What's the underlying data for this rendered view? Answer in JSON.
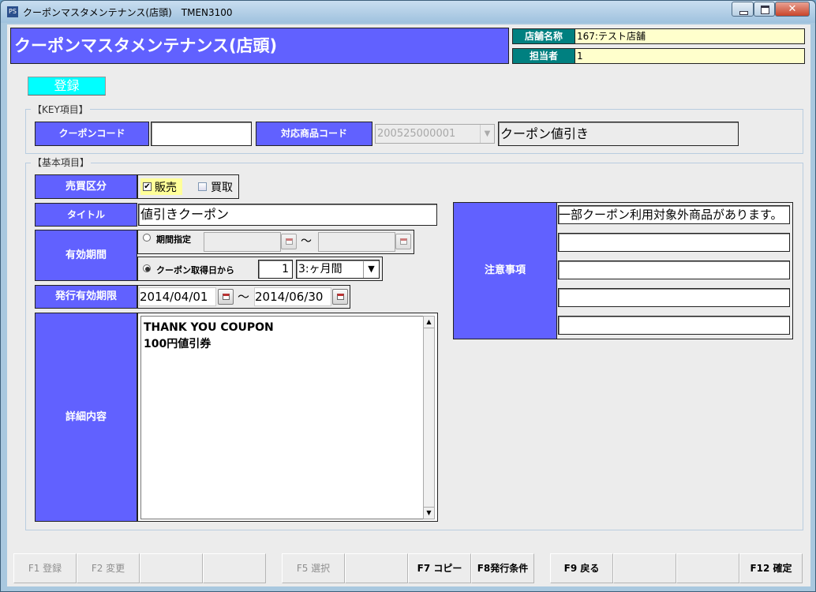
{
  "window": {
    "title": "クーポンマスタメンテナンス(店頭)　TMEN3100",
    "app_icon": "app-icon"
  },
  "header": {
    "title": "クーポンマスタメンテナンス(店頭)",
    "store_label": "店舗名称",
    "store_value": "167:テスト店舗",
    "staff_label": "担当者",
    "staff_value": "1"
  },
  "register_button": "登録",
  "key_section": {
    "legend": "【KEY項目】",
    "coupon_code_label": "クーポンコード",
    "coupon_code_value": "",
    "product_code_label": "対応商品コード",
    "product_code_value": "200525000001",
    "product_name": "クーポン値引き"
  },
  "basic_section": {
    "legend": "【基本項目】",
    "trade_label": "売買区分",
    "sale_label": "販売",
    "sale_checked": true,
    "buy_label": "買取",
    "buy_checked": false,
    "title_label": "タイトル",
    "title_value": "値引きクーポン",
    "validity_label": "有効期間",
    "period_radio_label": "期間指定",
    "tilde": "～",
    "from_acquire_label": "クーポン取得日から",
    "acquire_count": "1",
    "acquire_unit": "3:ヶ月間",
    "issue_label": "発行有効期限",
    "issue_from": "2014/04/01",
    "issue_to": "2014/06/30",
    "detail_label": "詳細内容",
    "detail_line1": "THANK YOU COUPON",
    "detail_line2": "100円値引券",
    "notes_label": "注意事項",
    "notes": [
      "一部クーポン利用対象外商品があります。",
      "",
      "",
      "",
      ""
    ]
  },
  "fkeys": [
    {
      "label": "F1 登録",
      "enabled": false
    },
    {
      "label": "F2 変更",
      "enabled": false
    },
    {
      "label": "",
      "enabled": false
    },
    {
      "label": "",
      "enabled": false
    },
    {
      "label": "F5 選択",
      "enabled": false
    },
    {
      "label": "",
      "enabled": false
    },
    {
      "label": "F7 コピー",
      "enabled": true
    },
    {
      "label": "F8発行条件",
      "enabled": true
    },
    {
      "label": "F9 戻る",
      "enabled": true
    },
    {
      "label": "",
      "enabled": false
    },
    {
      "label": "",
      "enabled": false
    },
    {
      "label": "F12 確定",
      "enabled": true
    }
  ],
  "colors": {
    "label_bg": "#6161ff",
    "info_label_bg": "#008080",
    "info_value_bg": "#ffffcc",
    "register_bg": "#00ffff",
    "sale_highlight": "#ffff99"
  }
}
